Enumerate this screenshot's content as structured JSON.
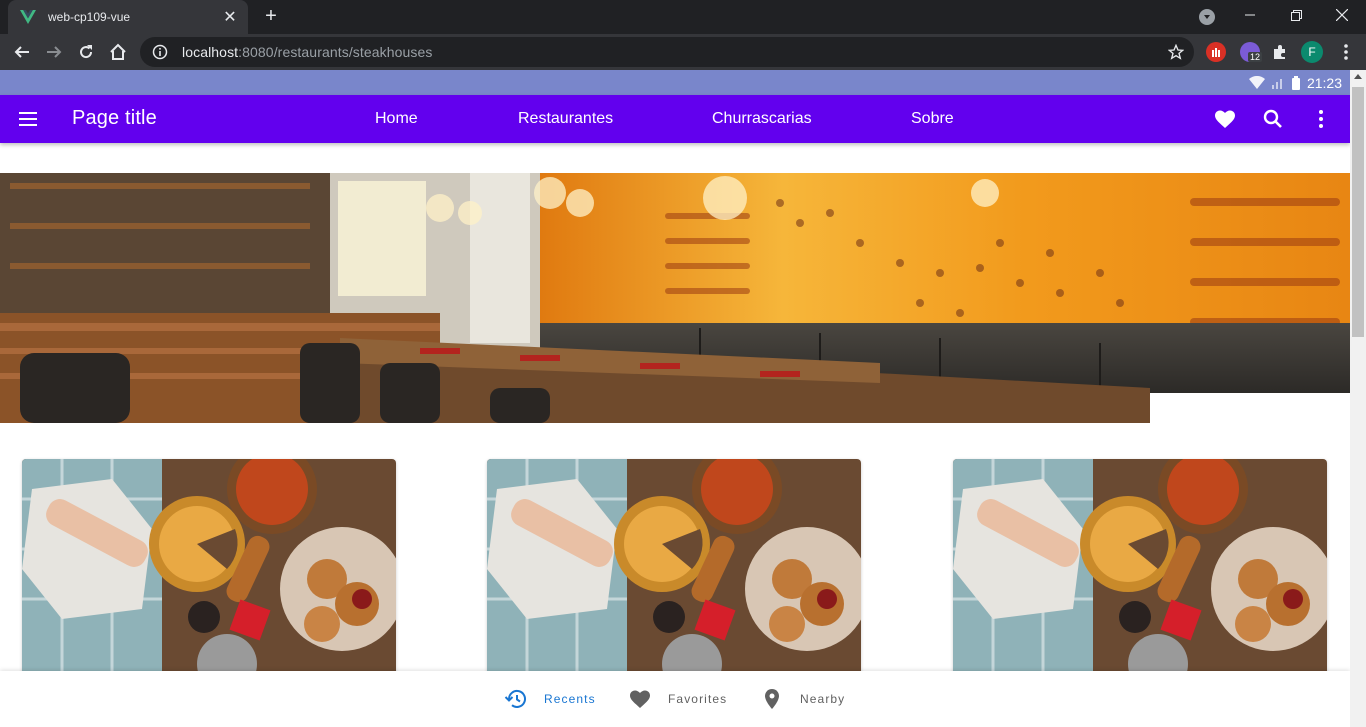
{
  "browser": {
    "tab_title": "web-cp109-vue",
    "new_tab_label": "+",
    "url_host": "localhost",
    "url_rest": ":8080/restaurants/steakhouses",
    "extension_badge": "12",
    "profile_initial": "F"
  },
  "status_bar": {
    "time": "21:23"
  },
  "app_bar": {
    "title": "Page title",
    "nav": [
      "Home",
      "Restaurantes",
      "Churrascarias",
      "Sobre"
    ]
  },
  "bottom_nav": {
    "items": [
      {
        "label": "Recents",
        "icon": "history-icon",
        "active": true
      },
      {
        "label": "Favorites",
        "icon": "heart-icon",
        "active": false
      },
      {
        "label": "Nearby",
        "icon": "map-marker-icon",
        "active": false
      }
    ]
  },
  "colors": {
    "app_bar": "#6200ee",
    "status_bar": "#7986cb",
    "active_nav": "#1976d2",
    "browser_dark": "#202124"
  }
}
